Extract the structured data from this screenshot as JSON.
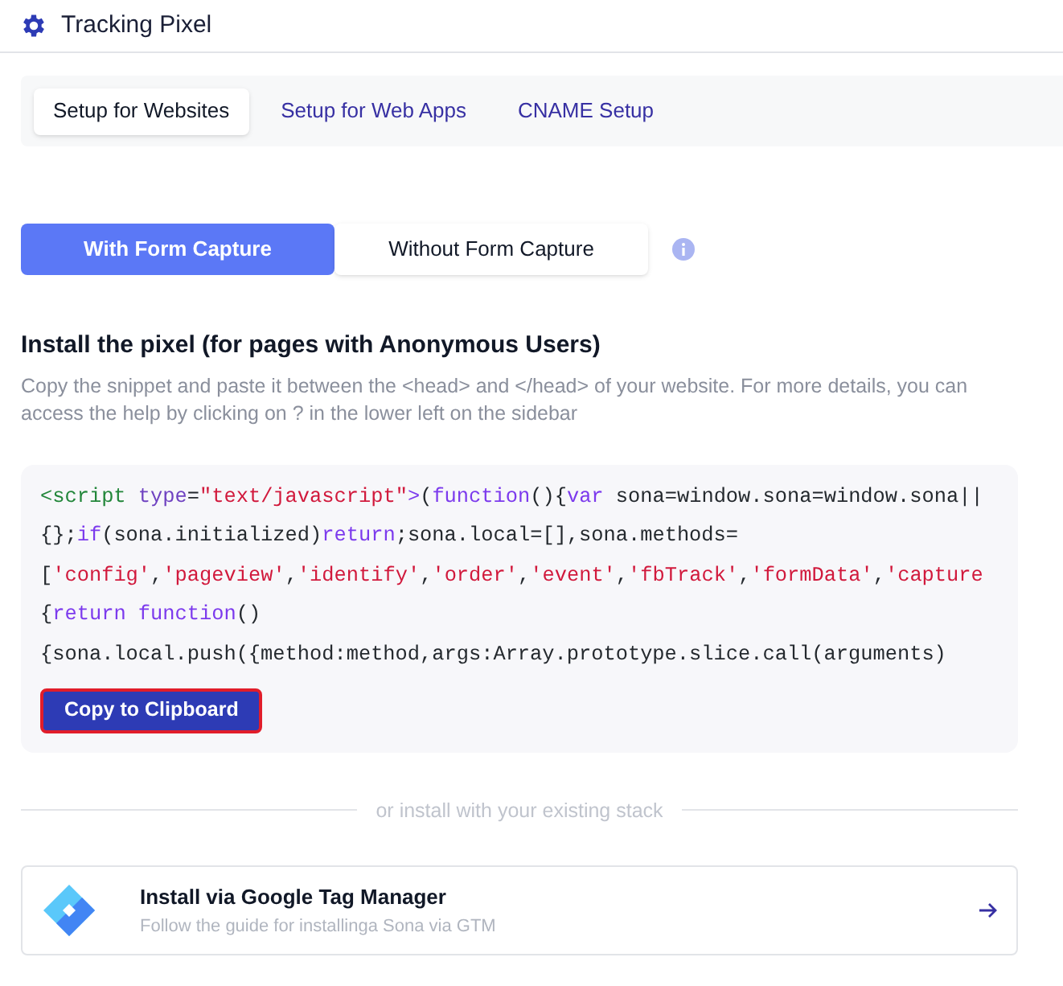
{
  "header": {
    "title": "Tracking Pixel"
  },
  "tabs": [
    {
      "label": "Setup for Websites",
      "selected": true
    },
    {
      "label": "Setup for Web Apps",
      "selected": false
    },
    {
      "label": "CNAME Setup",
      "selected": false
    }
  ],
  "capture_toggle": [
    {
      "label": "With Form Capture",
      "selected": true
    },
    {
      "label": "Without Form Capture",
      "selected": false
    }
  ],
  "section": {
    "heading": "Install the pixel (for pages with Anonymous Users)",
    "description": "Copy the snippet and paste it between the <head> and </head> of your website. For more details, you can access the help by clicking on ? in the lower left on the sidebar"
  },
  "code_lines": [
    [
      {
        "kind": "tag",
        "text": "<script"
      },
      {
        "kind": "attr",
        "text": " type"
      },
      {
        "kind": "plain",
        "text": "="
      },
      {
        "kind": "string",
        "text": "\"text/javascript\""
      },
      {
        "kind": "keyword",
        "text": ">"
      },
      {
        "kind": "plain",
        "text": "("
      },
      {
        "kind": "keyword",
        "text": "function"
      },
      {
        "kind": "plain",
        "text": "(){"
      },
      {
        "kind": "keyword",
        "text": "var"
      },
      {
        "kind": "plain",
        "text": " sona=window.sona=window.sona||"
      }
    ],
    [
      {
        "kind": "plain",
        "text": "{};"
      },
      {
        "kind": "keyword",
        "text": "if"
      },
      {
        "kind": "plain",
        "text": "(sona.initialized)"
      },
      {
        "kind": "keyword",
        "text": "return"
      },
      {
        "kind": "plain",
        "text": ";sona.local=[],sona.methods="
      }
    ],
    [
      {
        "kind": "plain",
        "text": "["
      },
      {
        "kind": "string",
        "text": "'config'"
      },
      {
        "kind": "plain",
        "text": ","
      },
      {
        "kind": "string",
        "text": "'pageview'"
      },
      {
        "kind": "plain",
        "text": ","
      },
      {
        "kind": "string",
        "text": "'identify'"
      },
      {
        "kind": "plain",
        "text": ","
      },
      {
        "kind": "string",
        "text": "'order'"
      },
      {
        "kind": "plain",
        "text": ","
      },
      {
        "kind": "string",
        "text": "'event'"
      },
      {
        "kind": "plain",
        "text": ","
      },
      {
        "kind": "string",
        "text": "'fbTrack'"
      },
      {
        "kind": "plain",
        "text": ","
      },
      {
        "kind": "string",
        "text": "'formData'"
      },
      {
        "kind": "plain",
        "text": ","
      },
      {
        "kind": "string",
        "text": "'capture"
      }
    ],
    [
      {
        "kind": "plain",
        "text": "{"
      },
      {
        "kind": "keyword",
        "text": "return"
      },
      {
        "kind": "keyword",
        "text": " function"
      },
      {
        "kind": "plain",
        "text": "()"
      }
    ],
    [
      {
        "kind": "plain",
        "text": "{sona.local.push({method:method,args:Array.prototype.slice.call(arguments)"
      }
    ]
  ],
  "copy_button": "Copy to Clipboard",
  "divider_text": "or install with your existing stack",
  "integration": {
    "title": "Install via Google Tag Manager",
    "subtitle": "Follow the guide for installinga Sona via GTM"
  }
}
